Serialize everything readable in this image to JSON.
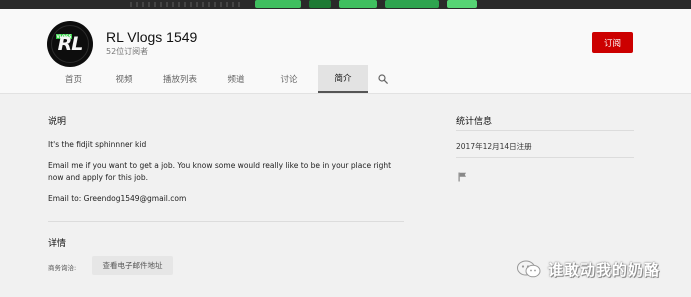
{
  "channel": {
    "name": "RL Vlogs 1549",
    "subscribers": "52位订阅者",
    "subscribe_label": "订阅",
    "avatar_monogram": "RL",
    "avatar_tag": "VLOGS"
  },
  "tabs": [
    {
      "label": "首页",
      "active": false
    },
    {
      "label": "视频",
      "active": false
    },
    {
      "label": "播放列表",
      "active": false
    },
    {
      "label": "频道",
      "active": false
    },
    {
      "label": "讨论",
      "active": false
    },
    {
      "label": "简介",
      "active": true
    }
  ],
  "about": {
    "description_title": "说明",
    "paragraphs": [
      "It's the fidjit sphinnner kid",
      "Email me if you want to get a job. You know some would really like to be in your place right now and apply for this job.",
      "Email to: Greendog1549@gmail.com"
    ],
    "details_title": "详情",
    "business_label": "商务询洽:",
    "view_email_label": "查看电子邮件地址"
  },
  "stats": {
    "title": "统计信息",
    "joined": "2017年12月14日注册"
  },
  "watermark": {
    "text": "谁敢动我的奶酪"
  },
  "colors": {
    "subscribe": "#cc0000",
    "active_tab_bg": "#e3e3e3",
    "banner_accent": "#2ea44f"
  },
  "icons": {
    "search": "search-icon",
    "flag": "flag-icon",
    "watermark": "wechat-icon"
  }
}
